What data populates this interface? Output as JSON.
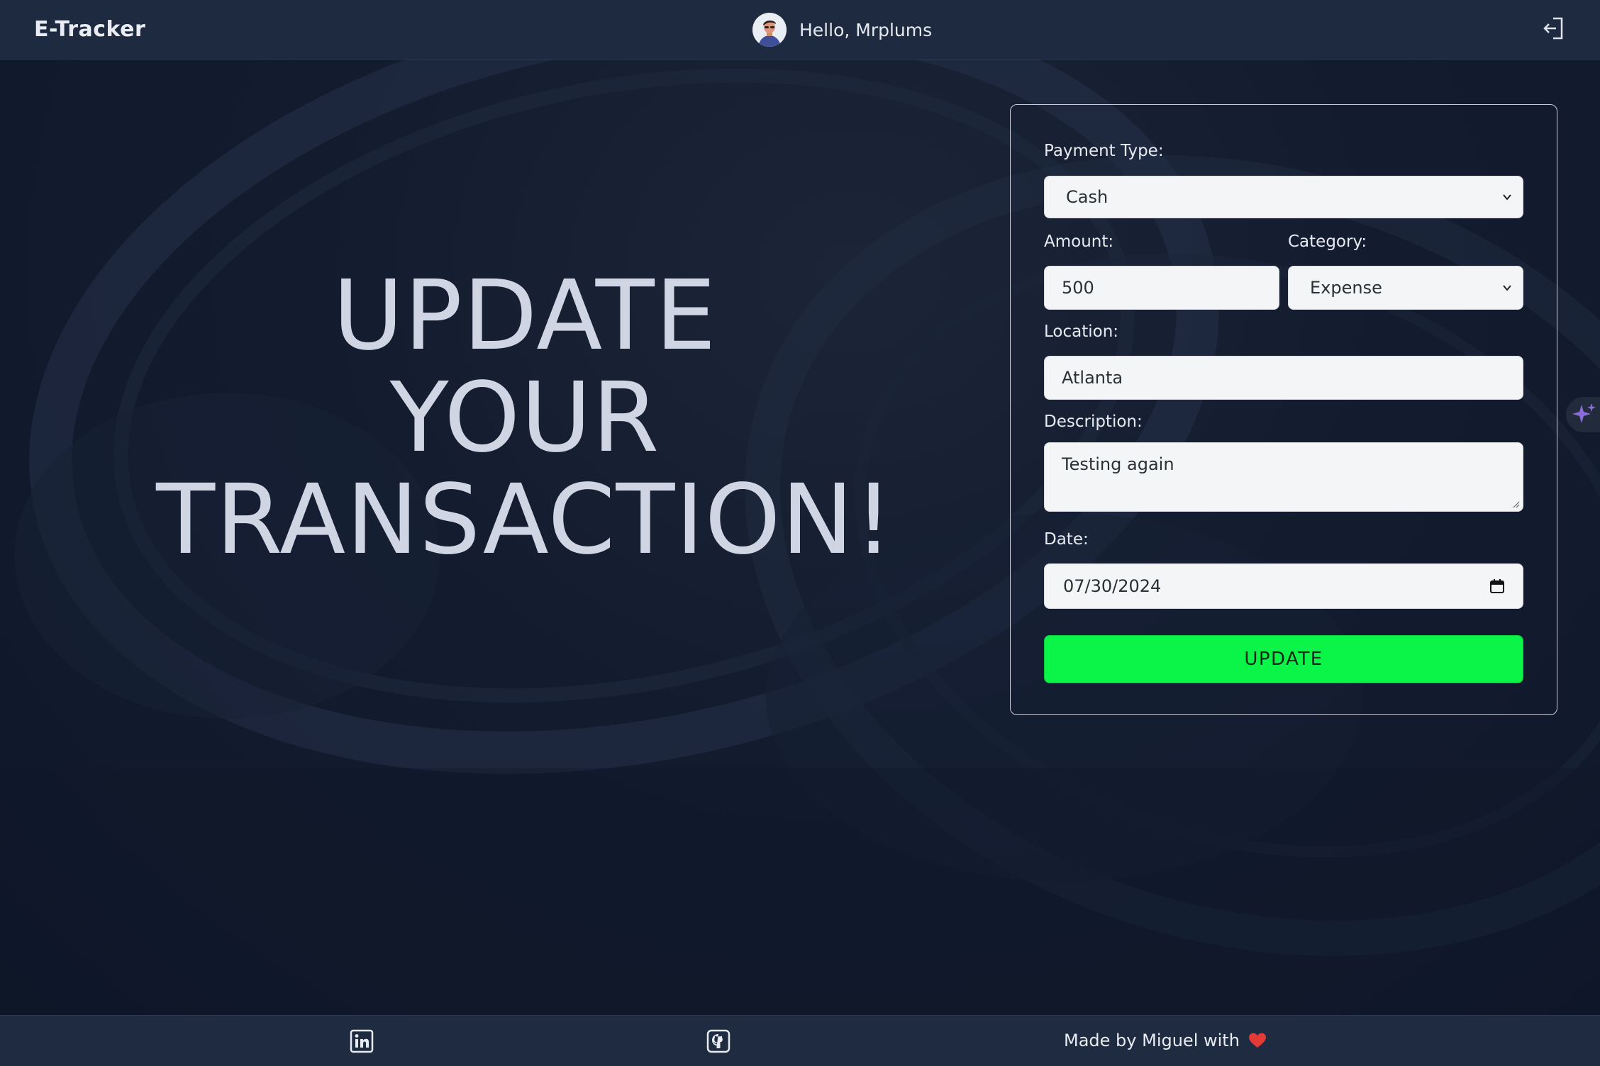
{
  "navbar": {
    "brand": "E-Tracker",
    "greeting": "Hello, Mrplums",
    "logout_icon": "logout-icon"
  },
  "hero": {
    "lines": [
      "UPDATE",
      "YOUR",
      "TRANSACTION!"
    ]
  },
  "form": {
    "payment_type": {
      "label": "Payment Type:",
      "value": "Cash"
    },
    "amount": {
      "label": "Amount:",
      "value": "500"
    },
    "category": {
      "label": "Category:",
      "value": "Expense"
    },
    "location": {
      "label": "Location:",
      "value": "Atlanta"
    },
    "description": {
      "label": "Description:",
      "value": "Testing again"
    },
    "date": {
      "label": "Date:",
      "value": "07/30/2024"
    },
    "submit_label": "UPDATE"
  },
  "footer": {
    "linkedin_icon": "linkedin-icon",
    "github_icon": "github-icon",
    "credit": "Made by Miguel with"
  },
  "colors": {
    "navbar_bg": "#1e2a3f",
    "page_bg": "#111a2d",
    "accent_button": "#0bf548",
    "heart": "#e53935"
  }
}
